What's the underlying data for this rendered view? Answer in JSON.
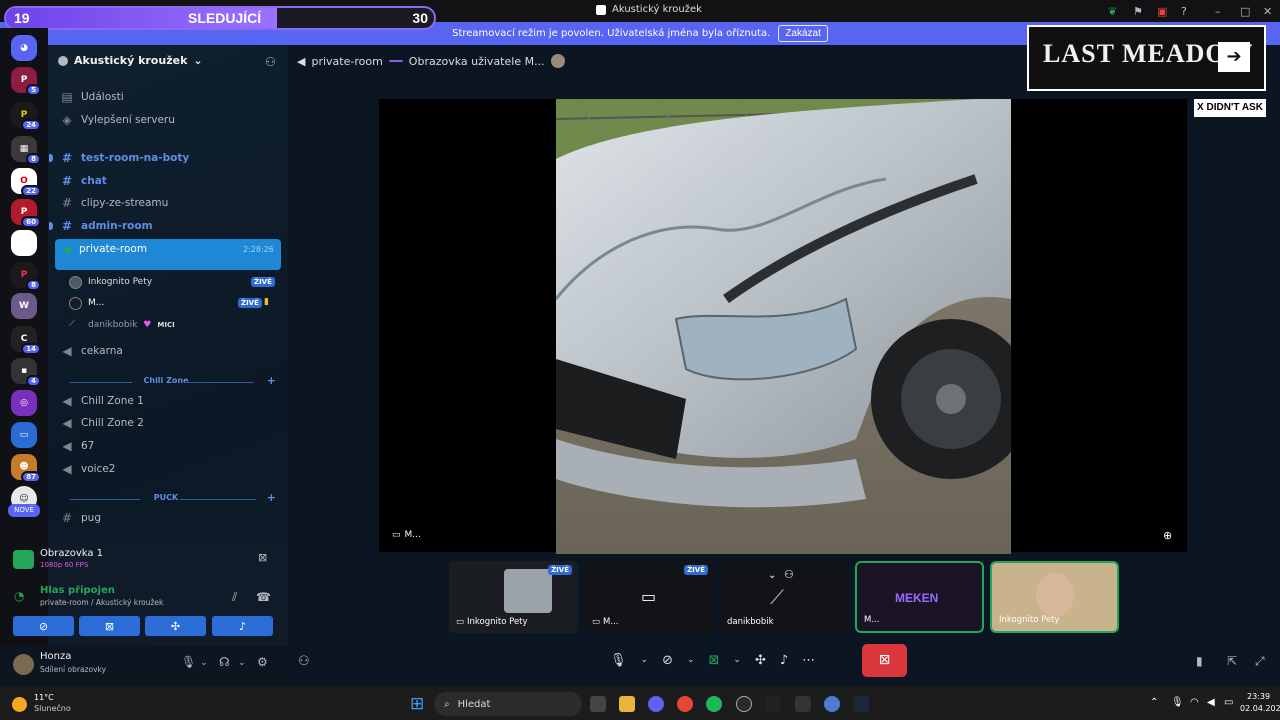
{
  "window": {
    "title": "Akustický kroužek"
  },
  "banner": {
    "text": "Streamovací režim je povolen. Uživatelská jména byla oříznuta.",
    "button": "Zakázat"
  },
  "follow_goal": {
    "current": "19",
    "label": "SLEDUJÍCÍ",
    "goal": "30",
    "progress": 0.633
  },
  "rail": {
    "new_label": "NOVÉ",
    "badges": [
      "5",
      "24",
      "8",
      "22",
      "60",
      "8",
      "14",
      "4",
      "87"
    ]
  },
  "server": {
    "name": "Akustický kroužek"
  },
  "sidebar": {
    "events": "Události",
    "boosts": "Vylepšení serveru",
    "channels": [
      {
        "name": "test-room-na-boty"
      },
      {
        "name": "chat"
      },
      {
        "name": "clipy-ze-streamu"
      },
      {
        "name": "admin-room"
      }
    ],
    "active_channel": {
      "name": "private-room",
      "time": "2:28:26"
    },
    "voice_users": [
      {
        "name": "Inkognito Pety",
        "badge": "ŽIVĚ"
      },
      {
        "name": "M...",
        "badge": "ŽIVĚ"
      },
      {
        "name": "danikbobik",
        "tag": "MICI"
      }
    ],
    "cekarna": "cekarna",
    "category_chill": "Chill Zone",
    "chill_channels": [
      "Chill Zone 1",
      "Chill Zone 2",
      "67",
      "voice2"
    ],
    "category_puck": "PUCK",
    "pug": "pug"
  },
  "stream_panel": {
    "title": "Obrazovka 1",
    "fps": "1080p 60 FPS",
    "voice_connected": "Hlas připojen",
    "voice_location": "private-room / Akustický kroužek"
  },
  "user": {
    "name": "Honza",
    "status": "Sdílení obrazovky"
  },
  "header": {
    "channel": "private-room",
    "screen": "Obrazovka uživatele M..."
  },
  "stage": {
    "label": "M..."
  },
  "tiles": [
    {
      "name": "Inkognito Pety",
      "badge": "ŽIVĚ"
    },
    {
      "name": "M...",
      "badge": "ŽIVĚ"
    },
    {
      "name": "danikbobik"
    },
    {
      "name": "M...",
      "logo": "MEKEN"
    },
    {
      "name": "Inkognito Pety"
    }
  ],
  "ad": {
    "title": "LAST MEADOW",
    "caption": "X DIDN'T ASK"
  },
  "taskbar": {
    "temp": "11°C",
    "weather": "Slunečno",
    "search": "Hledat",
    "time": "23:39",
    "date": "02.04.2026"
  },
  "colors": {
    "accent": "#5865f2",
    "active_channel": "#1e88d6",
    "live": "#2f6bd3",
    "end": "#da373c"
  }
}
